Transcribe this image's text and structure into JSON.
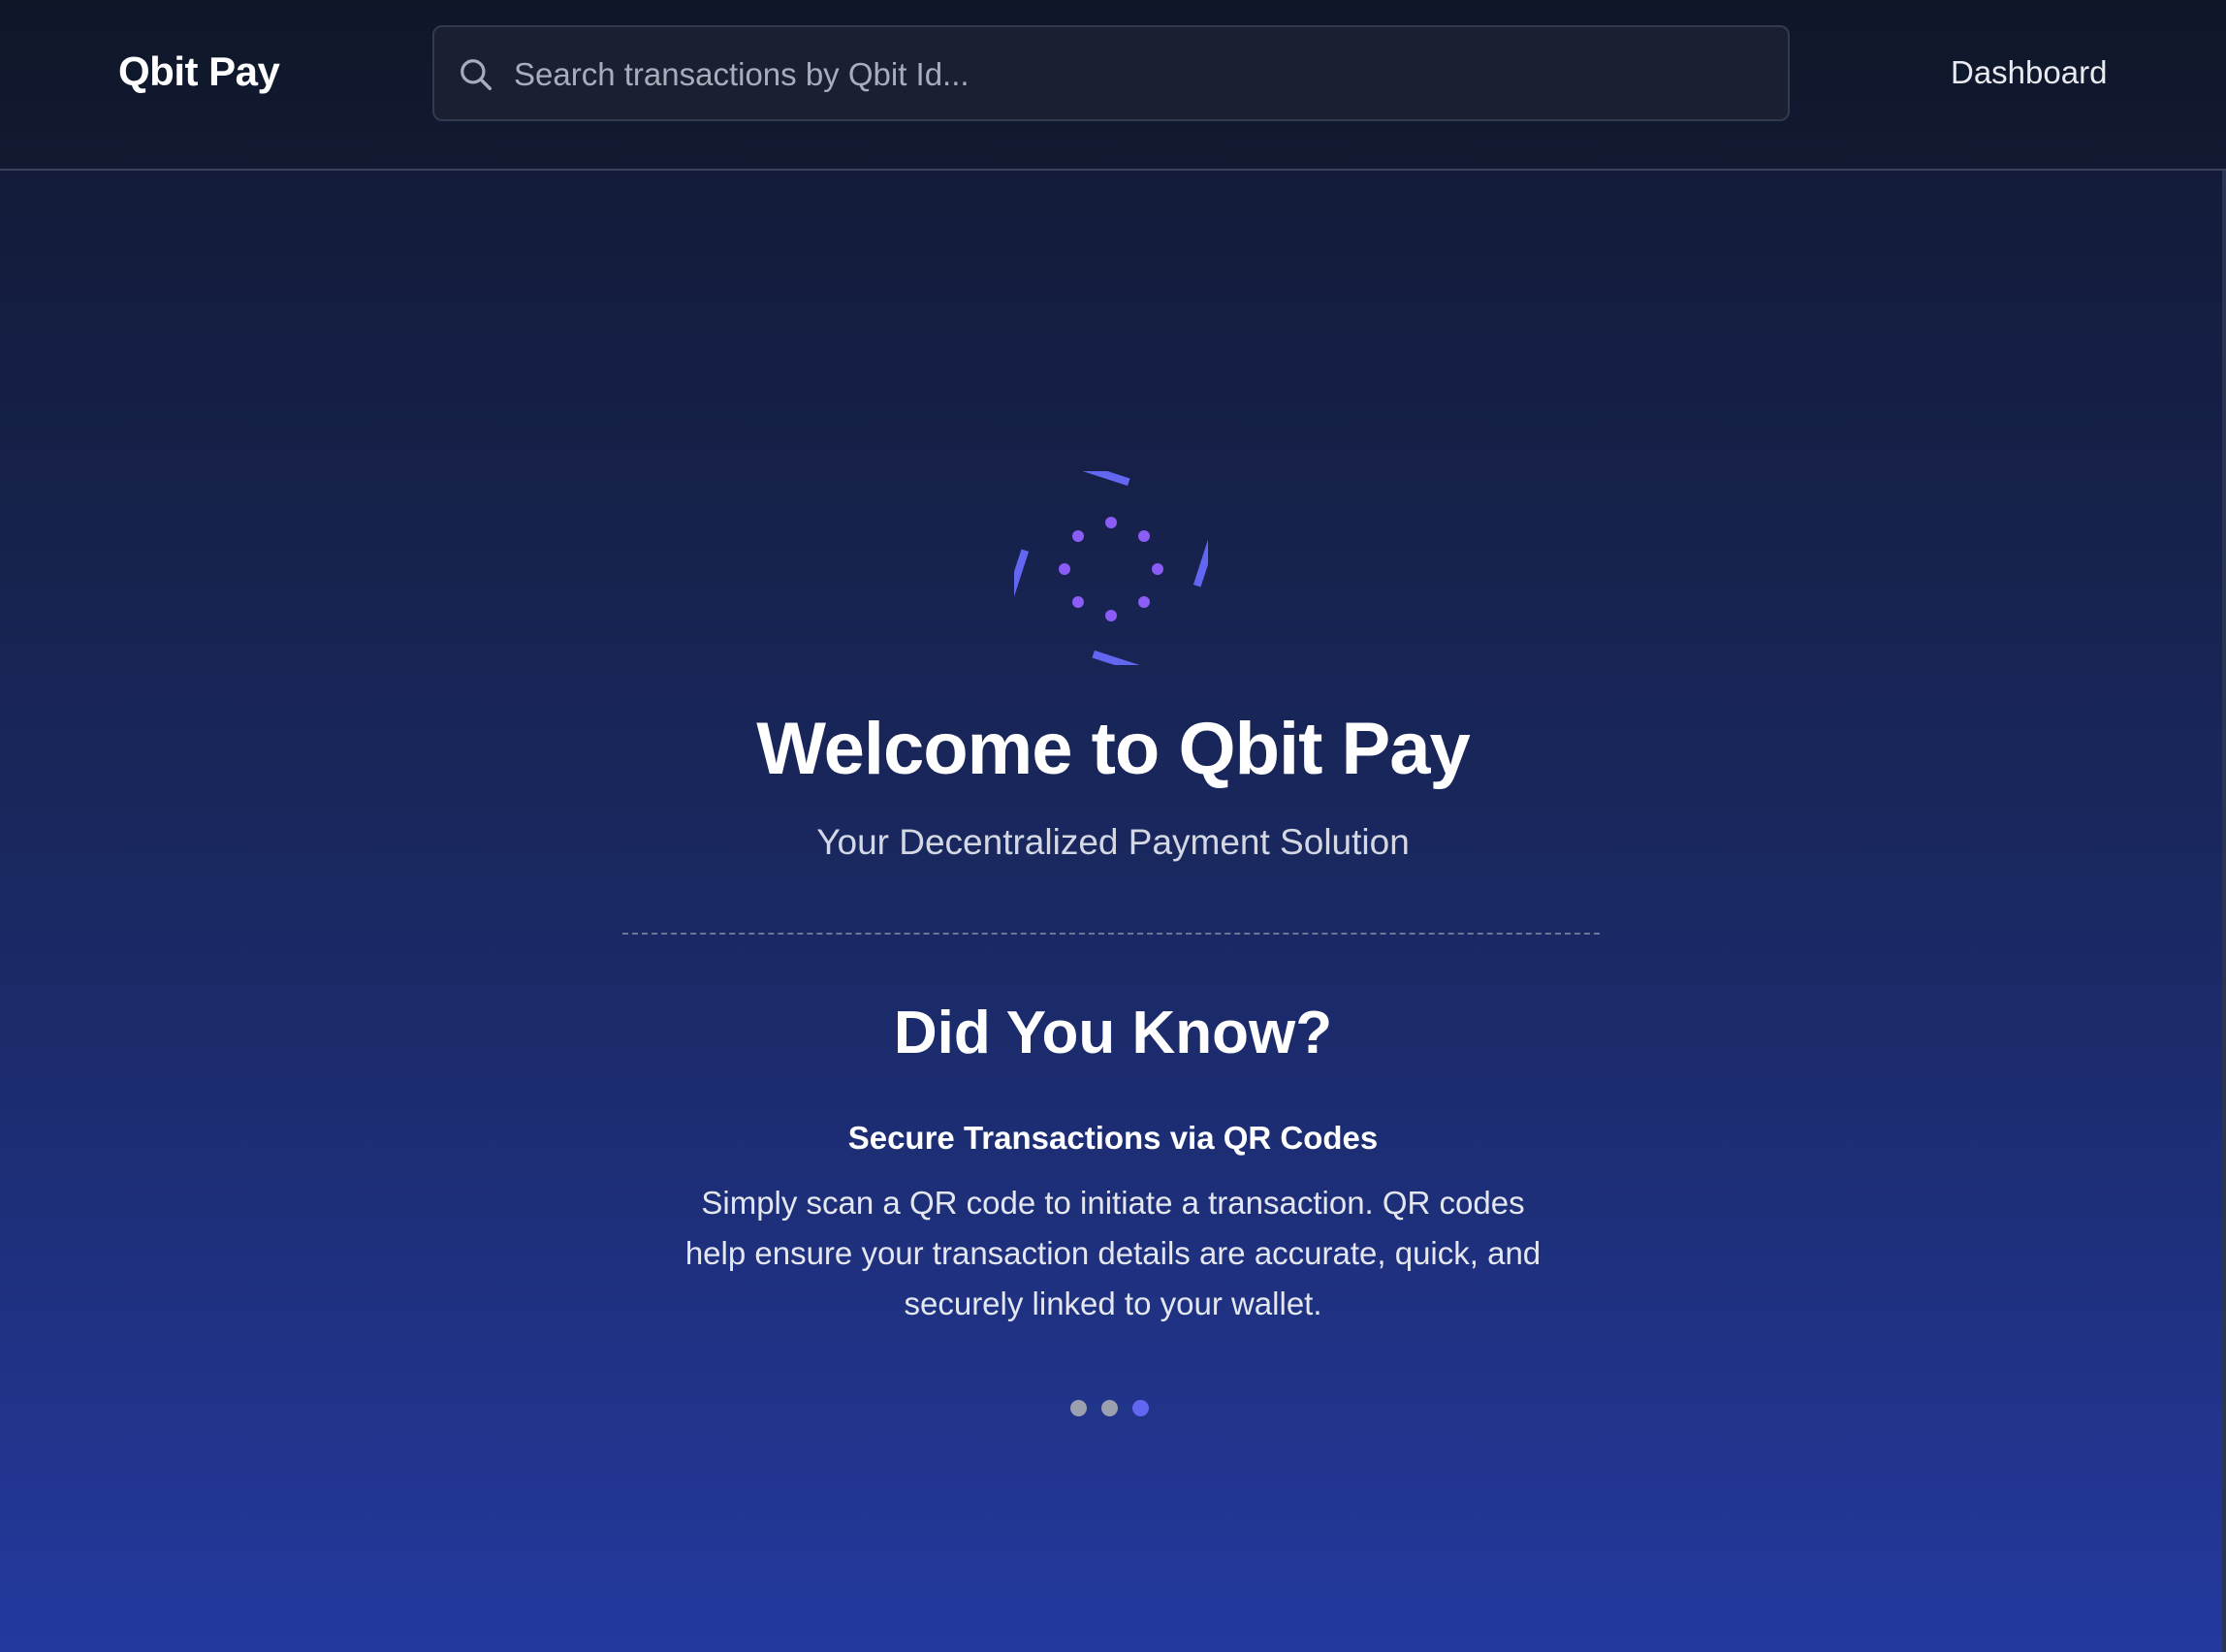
{
  "header": {
    "brand": "Qbit Pay",
    "search": {
      "placeholder": "Search transactions by Qbit Id...",
      "value": ""
    },
    "nav": {
      "dashboard_label": "Dashboard"
    }
  },
  "hero": {
    "title": "Welcome to Qbit Pay",
    "subtitle": "Your Decentralized Payment Solution"
  },
  "tips": {
    "heading": "Did You Know?",
    "current": {
      "title": "Secure Transactions via QR Codes",
      "body": "Simply scan a QR code to initiate a transaction. QR codes help ensure your transaction details are accurate, quick, and securely linked to your wallet."
    },
    "total_slides": 3,
    "active_index": 2
  },
  "icons": {
    "search": "search-icon",
    "logo": "spinner-logo-icon"
  },
  "colors": {
    "accent_indigo": "#6366f1",
    "accent_violet": "#8b5cf6",
    "dot_inactive": "#9aa0ad"
  }
}
